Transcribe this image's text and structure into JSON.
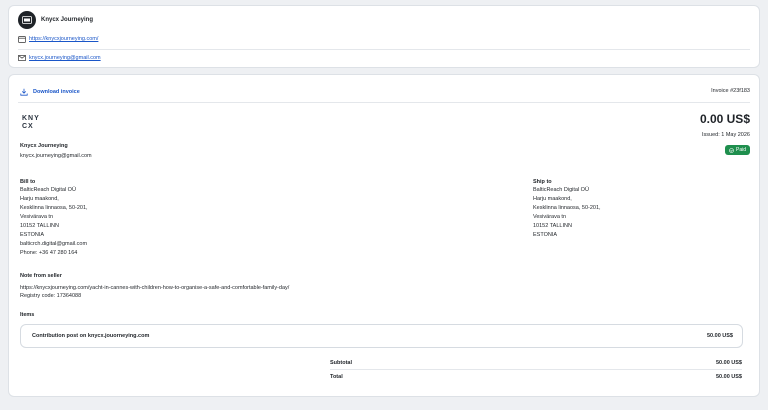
{
  "seller": {
    "name": "Knycx Journeying",
    "website": "https://knycxjourneying.com/",
    "email": "knycx.journeying@gmail.com",
    "logo_text": "KNY CX"
  },
  "invoice": {
    "download_label": "Download invoice",
    "number": "Invoice #23f183",
    "amount": "0.00 US$",
    "issued": "Issued: 1 May 2026",
    "status": "Paid"
  },
  "bill_to": {
    "heading": "Bill to",
    "lines": [
      "BalticReach Digital OÜ",
      "Harju maakond,",
      "Kesklinna linnaosa, 50-201,",
      "Vesivärava tn",
      "10152 TALLINN",
      "ESTONIA",
      "balticrch.digital@gmail.com",
      "Phone: +36 47 280 164"
    ]
  },
  "ship_to": {
    "heading": "Ship to",
    "lines": [
      "BalticReach Digital OÜ",
      "Harju maakond,",
      "Kesklinna linnaosa, 50-201,",
      "Vesivärava tn",
      "10152 TALLINN",
      "ESTONIA"
    ]
  },
  "note": {
    "heading": "Note from seller",
    "url": "https://knycxjourneying.com/yacht-in-cannes-with-children-how-to-organise-a-safe-and-comfortable-family-day/",
    "registry": "Registry code: 17364088"
  },
  "items": {
    "heading": "Items",
    "rows": [
      {
        "name": "Contribution post on knycx.jouorneying.com",
        "amount": "50.00 US$"
      }
    ]
  },
  "totals": {
    "subtotal_label": "Subtotal",
    "subtotal": "50.00 US$",
    "total_label": "Total",
    "total": "50.00 US$"
  },
  "colors": {
    "link": "#1a56c8",
    "paid": "#1f8f4e"
  }
}
